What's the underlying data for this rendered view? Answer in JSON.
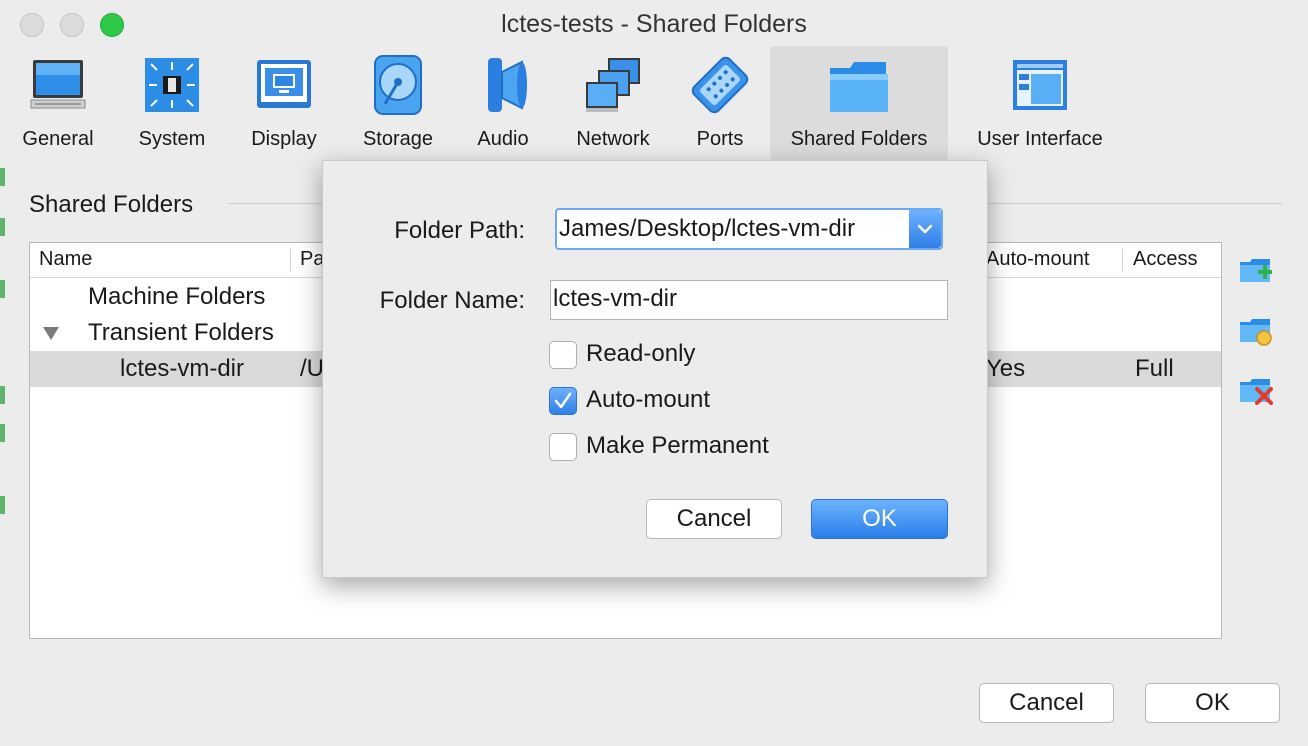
{
  "window": {
    "title": "lctes-tests - Shared Folders"
  },
  "toolbar": {
    "items": [
      {
        "label": "General",
        "icon": "monitor-icon"
      },
      {
        "label": "System",
        "icon": "chip-icon"
      },
      {
        "label": "Display",
        "icon": "display-icon"
      },
      {
        "label": "Storage",
        "icon": "disk-icon"
      },
      {
        "label": "Audio",
        "icon": "speaker-icon"
      },
      {
        "label": "Network",
        "icon": "network-icon"
      },
      {
        "label": "Ports",
        "icon": "port-icon"
      },
      {
        "label": "Shared Folders",
        "icon": "folder-icon",
        "selected": true
      },
      {
        "label": "User Interface",
        "icon": "window-icon"
      }
    ]
  },
  "section": {
    "title": "Shared Folders"
  },
  "table": {
    "columns": [
      "Name",
      "Pa",
      "Auto-mount",
      "Access"
    ],
    "rows": [
      {
        "name": "Machine Folders",
        "path": "",
        "automount": "",
        "access": ""
      },
      {
        "name": "Transient Folders",
        "path": "",
        "automount": "",
        "access": "",
        "expanded": true
      },
      {
        "name": "lctes-vm-dir",
        "path": "/U",
        "automount": "Yes",
        "access": "Full",
        "selected": true
      }
    ]
  },
  "side_buttons": {
    "add": "add-folder-icon",
    "edit": "edit-folder-icon",
    "remove": "remove-folder-icon"
  },
  "dialog": {
    "path_label": "Folder Path:",
    "path_value": "James/Desktop/lctes-vm-dir",
    "name_label": "Folder Name:",
    "name_value": "lctes-vm-dir",
    "readonly_label": "Read-only",
    "readonly_checked": false,
    "automount_label": "Auto-mount",
    "automount_checked": true,
    "permanent_label": "Make Permanent",
    "permanent_checked": false,
    "cancel_label": "Cancel",
    "ok_label": "OK"
  },
  "footer": {
    "cancel_label": "Cancel",
    "ok_label": "OK"
  },
  "colors": {
    "accent": "#2f7fe8",
    "selected_row": "#dadada",
    "toolbar_selected": "#dcdcdc"
  }
}
